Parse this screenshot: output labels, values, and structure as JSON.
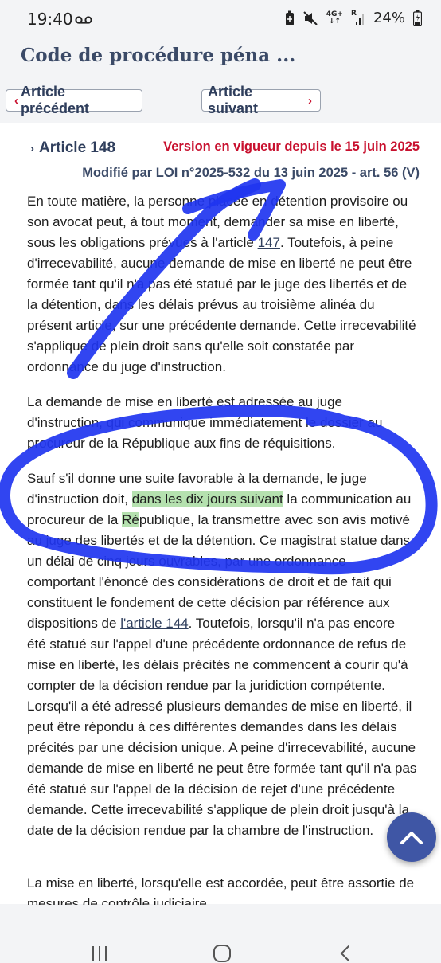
{
  "status_bar": {
    "time": "19:40",
    "network": "4G+",
    "roaming": "R",
    "battery": "24%",
    "icons": [
      "voicemail-icon",
      "battery-saver-icon",
      "mute-icon",
      "signal-icon",
      "battery-icon"
    ]
  },
  "header": {
    "title": "Code de procédure péna ..."
  },
  "nav": {
    "prev_label": "Article précédent",
    "next_label": "Article suivant"
  },
  "article": {
    "number": "Article 148",
    "version": "Version en vigueur depuis le 15 juin 2025",
    "modified": "Modifié par LOI n°2025-532 du 13 juin 2025 - art. 56 (V)",
    "p1_a": "En toute matière, la personne placée en détention provisoire ou son avocat peut, à tout moment, demander sa mise en liberté, sous les obligations prévues à l'article ",
    "p1_link": "147",
    "p1_b": ". Toutefois, à peine d'irrecevabilité, aucune demande de mise en liberté ne peut être formée tant qu'il n'a pas été statué par le juge des libertés et de la détention, dans les délais prévus au troisième alinéa du présent article, sur une précédente demande. Cette irrecevabilité s'applique de plein droit sans qu'elle soit constatée par ordonnance du juge d'instruction.",
    "p2": "La demande de mise en liberté est adressée au juge d'instruction, qui communique immédiatement le dossier au procureur de la République aux fins de réquisitions.",
    "p3_a": "Sauf s'il donne une suite favorable à la demande, le juge d'instruction doit, ",
    "p3_hl1": "dans les dix jours suivant",
    "p3_b": " la communication au procureur de la ",
    "p3_hl2": "Ré",
    "p3_c": "publique, la transmettre avec son avis motivé au juge des libertés et de la détention. Ce magistrat statue dans un délai de cinq jours ouvrables, par une ordonnance comportant l'énoncé des considérations de droit et de fait qui constituent le fondement de cette décision par référence aux dispositions de ",
    "p3_link": "l'article 144",
    "p3_d": ". Toutefois, lorsqu'il n'a pas encore été statué sur l'appel d'une précédente ordonnance de refus de mise en liberté, les délais précités ne commencent à courir qu'à compter de la décision rendue par la juridiction compétente. Lorsqu'il a été adressé plusieurs demandes de mise en liberté, il peut être répondu à ces différentes demandes dans les délais précités par une décision unique. A peine d'irrecevabilité, aucune demande de mise en liberté ne peut être formée tant qu'il n'a pas été statué sur l'appel de la décision de rejet d'une précédente demande. Cette irrecevabilité s'applique de plein droit jusqu'à la date de la décision rendue par la chambre de l'instruction.",
    "p4": "La mise en liberté, lorsqu'elle est accordée, peut être assortie de mesures de contrôle judiciaire."
  },
  "colors": {
    "accent_red": "#c8102e",
    "title_blue": "#3b4a67",
    "annotation_blue": "#1f35f0",
    "highlight_green": "#78c86e",
    "fab_blue": "#3f56a5"
  }
}
